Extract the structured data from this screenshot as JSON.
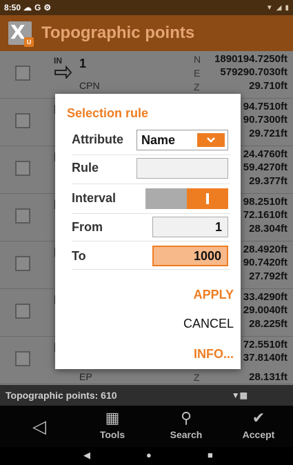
{
  "status_bar": {
    "time": "8:50",
    "left_icons": [
      "cloud-icon",
      "google-icon",
      "settings-icon"
    ],
    "right_icons": [
      "wifi-icon",
      "signal-icon",
      "battery-icon"
    ]
  },
  "app_bar": {
    "title": "Topographic points"
  },
  "rows": [
    {
      "icon": "IN arrow",
      "name": "1",
      "code": "CPN",
      "N": "1890194.7250ft",
      "E": "579290.7030ft",
      "Z": "29.710ft"
    },
    {
      "N": "94.7510ft",
      "E": "90.7300ft",
      "Z": "29.721ft"
    },
    {
      "N": "24.4760ft",
      "E": "59.4270ft",
      "Z": "29.377ft"
    },
    {
      "N": "98.2510ft",
      "E": "72.1610ft",
      "Z": "28.304ft"
    },
    {
      "N": "28.4920ft",
      "E": "90.7420ft",
      "Z": "27.792ft"
    },
    {
      "N": "33.4290ft",
      "E": "29.0040ft",
      "Z": "28.225ft"
    },
    {
      "N": "72.5510ft",
      "E": "37.8140ft",
      "Z": "28.131ft",
      "code": "EP"
    }
  ],
  "coord_labels": {
    "n": "N",
    "e": "E",
    "z": "Z"
  },
  "footer": {
    "count_text": "Topographic points: 610"
  },
  "nav": {
    "tools": "Tools",
    "search": "Search",
    "accept": "Accept"
  },
  "dialog": {
    "title": "Selection rule",
    "attribute_label": "Attribute",
    "attribute_value": "Name",
    "rule_label": "Rule",
    "rule_value": "",
    "interval_label": "Interval",
    "interval_on": true,
    "from_label": "From",
    "from_value": "1",
    "to_label": "To",
    "to_value": "1000",
    "apply": "APPLY",
    "cancel": "CANCEL",
    "info": "INFO..."
  },
  "colors": {
    "accent": "#ee7d22",
    "appbar": "#8c4a14"
  }
}
